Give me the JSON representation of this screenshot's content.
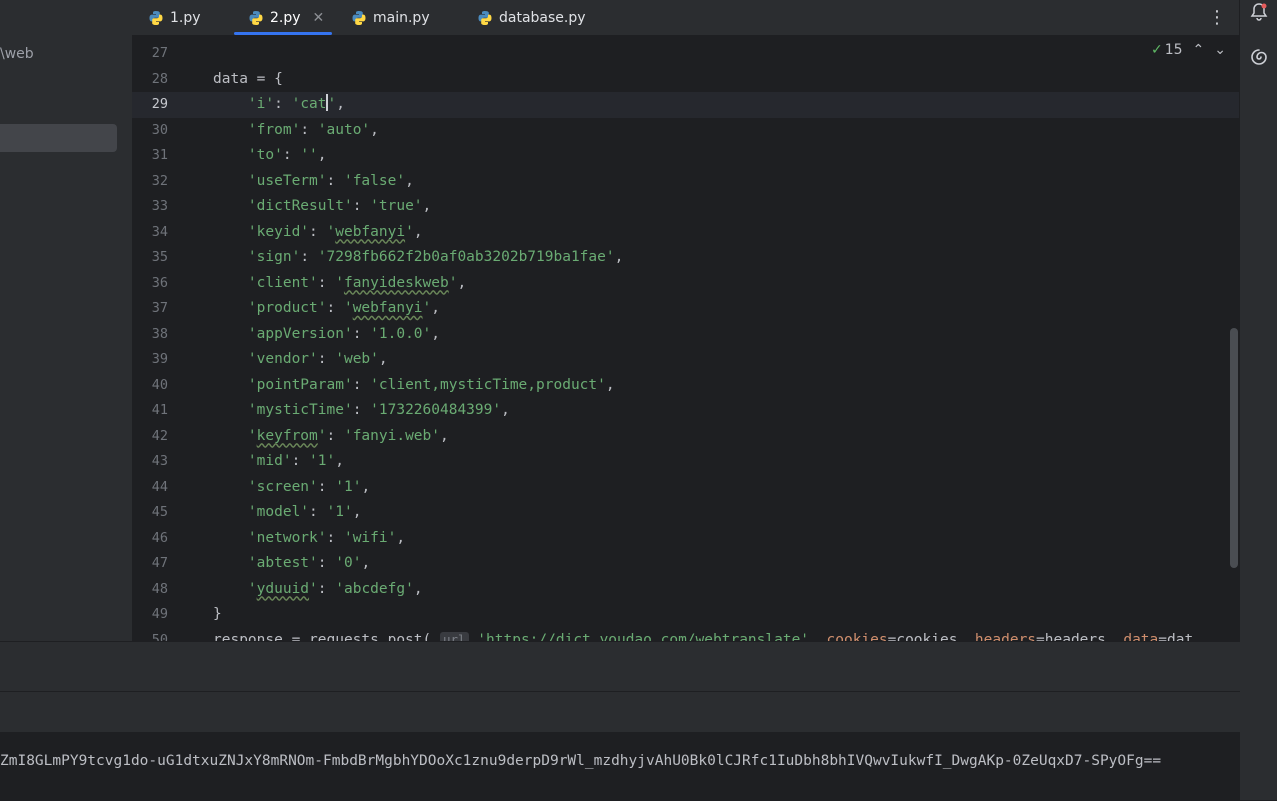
{
  "project_panel": {
    "path_fragment": "\\web"
  },
  "tabs": [
    {
      "label": "1.py",
      "icon": "python-file-icon"
    },
    {
      "label": "2.py",
      "icon": "python-file-icon",
      "active": true
    },
    {
      "label": "main.py",
      "icon": "python-file-icon"
    },
    {
      "label": "database.py",
      "icon": "python-file-icon"
    }
  ],
  "inspection": {
    "count": "15"
  },
  "editor": {
    "current_line": "29",
    "lines": [
      {
        "n": "27",
        "text": ""
      },
      {
        "n": "28",
        "text": "data = {"
      },
      {
        "n": "29",
        "key": "'i'",
        "val": "'cat'"
      },
      {
        "n": "30",
        "key": "'from'",
        "val": "'auto'"
      },
      {
        "n": "31",
        "key": "'to'",
        "val": "''"
      },
      {
        "n": "32",
        "key": "'useTerm'",
        "val": "'false'"
      },
      {
        "n": "33",
        "key": "'dictResult'",
        "val": "'true'"
      },
      {
        "n": "34",
        "key": "'keyid'",
        "val": "'webfanyi'"
      },
      {
        "n": "35",
        "key": "'sign'",
        "val": "'7298fb662f2b0af0ab3202b719ba1fae'"
      },
      {
        "n": "36",
        "key": "'client'",
        "val": "'fanyideskweb'"
      },
      {
        "n": "37",
        "key": "'product'",
        "val": "'webfanyi'"
      },
      {
        "n": "38",
        "key": "'appVersion'",
        "val": "'1.0.0'"
      },
      {
        "n": "39",
        "key": "'vendor'",
        "val": "'web'"
      },
      {
        "n": "40",
        "key": "'pointParam'",
        "val": "'client,mysticTime,product'"
      },
      {
        "n": "41",
        "key": "'mysticTime'",
        "val": "'1732260484399'"
      },
      {
        "n": "42",
        "key": "'keyfrom'",
        "val": "'fanyi.web'"
      },
      {
        "n": "43",
        "key": "'mid'",
        "val": "'1'"
      },
      {
        "n": "44",
        "key": "'screen'",
        "val": "'1'"
      },
      {
        "n": "45",
        "key": "'model'",
        "val": "'1'"
      },
      {
        "n": "46",
        "key": "'network'",
        "val": "'wifi'"
      },
      {
        "n": "47",
        "key": "'abtest'",
        "val": "'0'"
      },
      {
        "n": "48",
        "key": "'yduuid'",
        "val": "'abcdefg'"
      },
      {
        "n": "49",
        "text": "}"
      },
      {
        "n": "50",
        "text": "response = requests.post( url 'https://dict.youdao.com/webtranslate', cookies=cookies, headers=headers, data=dat"
      }
    ]
  },
  "console": {
    "output": "ZmI8GLmPY9tcvg1do-uG1dtxuZNJxY8mRNOm-FmbdBrMgbhYDOoXc1znu9derpD9rWl_mzdhyjvAhU0Bk0lCJRfc1IuDbh8bhIVQwvIukwfI_DwgAKp-0ZeUqxD7-SPyOFg=="
  }
}
